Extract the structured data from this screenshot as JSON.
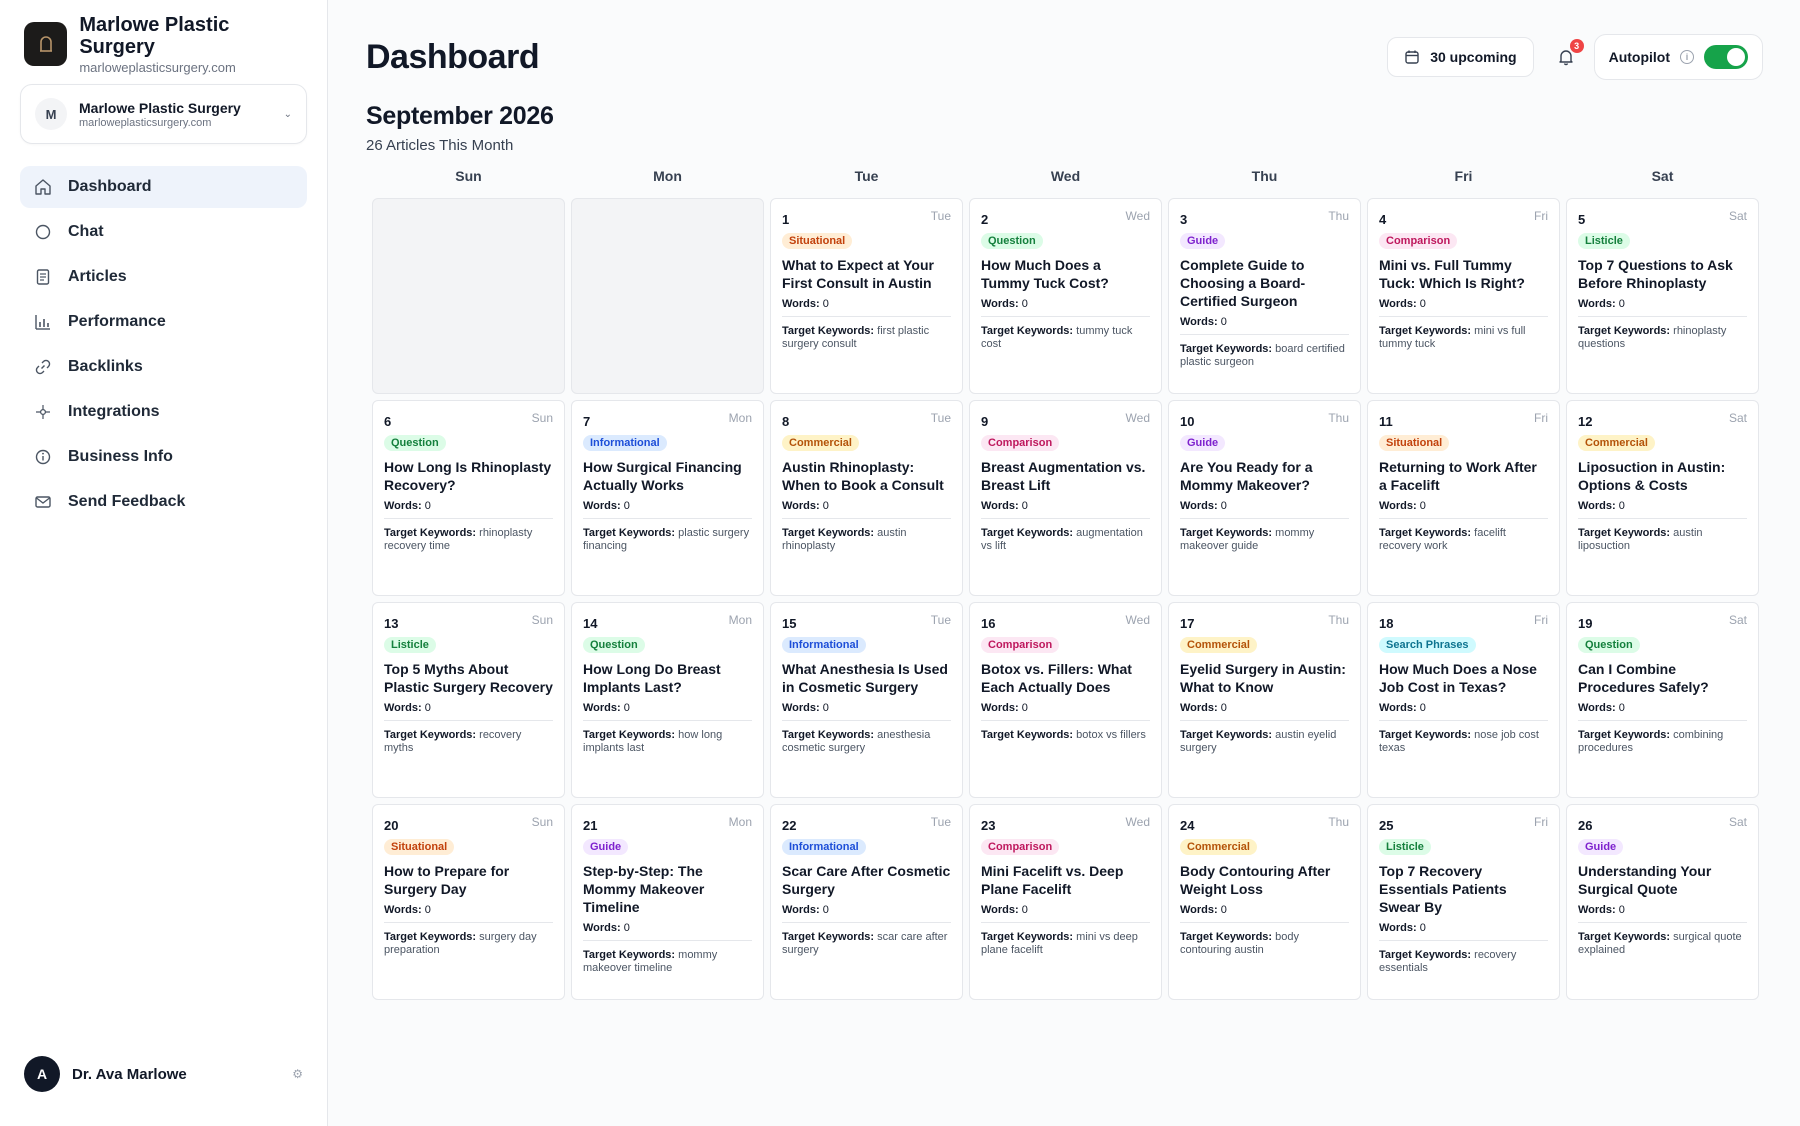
{
  "brand": {
    "name": "Marlowe Plastic Surgery",
    "domain": "marloweplasticsurgery.com"
  },
  "site_select": {
    "initial": "M",
    "name": "Marlowe Plastic Surgery",
    "domain": "marloweplasticsurgery.com"
  },
  "nav": [
    {
      "label": "Dashboard",
      "icon": "home-icon",
      "active": true
    },
    {
      "label": "Chat",
      "icon": "chat-icon"
    },
    {
      "label": "Articles",
      "icon": "document-icon"
    },
    {
      "label": "Performance",
      "icon": "bar-chart-icon"
    },
    {
      "label": "Backlinks",
      "icon": "link-icon"
    },
    {
      "label": "Integrations",
      "icon": "sparkle-icon"
    },
    {
      "label": "Business Info",
      "icon": "info-icon"
    },
    {
      "label": "Send Feedback",
      "icon": "mail-icon"
    }
  ],
  "user": {
    "initial": "A",
    "name": "Dr. Ava Marlowe"
  },
  "header": {
    "title": "Dashboard",
    "upcoming_label": "30 upcoming",
    "notification_count": "3",
    "autopilot_label": "Autopilot",
    "autopilot_on": true
  },
  "calendar": {
    "month_title": "September 2026",
    "subtitle": "26 Articles This Month",
    "weekdays": [
      "Sun",
      "Mon",
      "Tue",
      "Wed",
      "Thu",
      "Fri",
      "Sat"
    ],
    "leading_empty": 2,
    "words_label": "Words:",
    "keywords_label": "Target Keywords:",
    "tag_colors": {
      "Situational": {
        "bg": "#ffedd5",
        "fg": "#c2410c"
      },
      "Question": {
        "bg": "#dcfce7",
        "fg": "#15803d"
      },
      "Guide": {
        "bg": "#f3e8ff",
        "fg": "#7e22ce"
      },
      "Comparison": {
        "bg": "#fce7f3",
        "fg": "#be185d"
      },
      "Listicle": {
        "bg": "#dcfce7",
        "fg": "#15803d"
      },
      "Informational": {
        "bg": "#dbeafe",
        "fg": "#1d4ed8"
      },
      "Commercial": {
        "bg": "#fef3c7",
        "fg": "#b45309"
      },
      "Search Phrases": {
        "bg": "#cffafe",
        "fg": "#0e7490"
      }
    },
    "days": [
      {
        "day": "1",
        "dow": "Tue",
        "tag": "Situational",
        "title": "What to Expect at Your First Consult in Austin",
        "words": "0",
        "keywords": "first plastic surgery consult"
      },
      {
        "day": "2",
        "dow": "Wed",
        "tag": "Question",
        "title": "How Much Does a Tummy Tuck Cost?",
        "words": "0",
        "keywords": "tummy tuck cost"
      },
      {
        "day": "3",
        "dow": "Thu",
        "tag": "Guide",
        "title": "Complete Guide to Choosing a Board-Certified Surgeon",
        "words": "0",
        "keywords": "board certified plastic surgeon"
      },
      {
        "day": "4",
        "dow": "Fri",
        "tag": "Comparison",
        "title": "Mini vs. Full Tummy Tuck: Which Is Right?",
        "words": "0",
        "keywords": "mini vs full tummy tuck"
      },
      {
        "day": "5",
        "dow": "Sat",
        "tag": "Listicle",
        "title": "Top 7 Questions to Ask Before Rhinoplasty",
        "words": "0",
        "keywords": "rhinoplasty questions"
      },
      {
        "day": "6",
        "dow": "Sun",
        "tag": "Question",
        "title": "How Long Is Rhinoplasty Recovery?",
        "words": "0",
        "keywords": "rhinoplasty recovery time"
      },
      {
        "day": "7",
        "dow": "Mon",
        "tag": "Informational",
        "title": "How Surgical Financing Actually Works",
        "words": "0",
        "keywords": "plastic surgery financing"
      },
      {
        "day": "8",
        "dow": "Tue",
        "tag": "Commercial",
        "title": "Austin Rhinoplasty: When to Book a Consult",
        "words": "0",
        "keywords": "austin rhinoplasty"
      },
      {
        "day": "9",
        "dow": "Wed",
        "tag": "Comparison",
        "title": "Breast Augmentation vs. Breast Lift",
        "words": "0",
        "keywords": "augmentation vs lift"
      },
      {
        "day": "10",
        "dow": "Thu",
        "tag": "Guide",
        "title": "Are You Ready for a Mommy Makeover?",
        "words": "0",
        "keywords": "mommy makeover guide"
      },
      {
        "day": "11",
        "dow": "Fri",
        "tag": "Situational",
        "title": "Returning to Work After a Facelift",
        "words": "0",
        "keywords": "facelift recovery work"
      },
      {
        "day": "12",
        "dow": "Sat",
        "tag": "Commercial",
        "title": "Liposuction in Austin: Options & Costs",
        "words": "0",
        "keywords": "austin liposuction"
      },
      {
        "day": "13",
        "dow": "Sun",
        "tag": "Listicle",
        "title": "Top 5 Myths About Plastic Surgery Recovery",
        "words": "0",
        "keywords": "recovery myths"
      },
      {
        "day": "14",
        "dow": "Mon",
        "tag": "Question",
        "title": "How Long Do Breast Implants Last?",
        "words": "0",
        "keywords": "how long implants last"
      },
      {
        "day": "15",
        "dow": "Tue",
        "tag": "Informational",
        "title": "What Anesthesia Is Used in Cosmetic Surgery",
        "words": "0",
        "keywords": "anesthesia cosmetic surgery"
      },
      {
        "day": "16",
        "dow": "Wed",
        "tag": "Comparison",
        "title": "Botox vs. Fillers: What Each Actually Does",
        "words": "0",
        "keywords": "botox vs fillers"
      },
      {
        "day": "17",
        "dow": "Thu",
        "tag": "Commercial",
        "title": "Eyelid Surgery in Austin: What to Know",
        "words": "0",
        "keywords": "austin eyelid surgery"
      },
      {
        "day": "18",
        "dow": "Fri",
        "tag": "Search Phrases",
        "title": "How Much Does a Nose Job Cost in Texas?",
        "words": "0",
        "keywords": "nose job cost texas"
      },
      {
        "day": "19",
        "dow": "Sat",
        "tag": "Question",
        "title": "Can I Combine Procedures Safely?",
        "words": "0",
        "keywords": "combining procedures"
      },
      {
        "day": "20",
        "dow": "Sun",
        "tag": "Situational",
        "title": "How to Prepare for Surgery Day",
        "words": "0",
        "keywords": "surgery day preparation"
      },
      {
        "day": "21",
        "dow": "Mon",
        "tag": "Guide",
        "title": "Step-by-Step: The Mommy Makeover Timeline",
        "words": "0",
        "keywords": "mommy makeover timeline"
      },
      {
        "day": "22",
        "dow": "Tue",
        "tag": "Informational",
        "title": "Scar Care After Cosmetic Surgery",
        "words": "0",
        "keywords": "scar care after surgery"
      },
      {
        "day": "23",
        "dow": "Wed",
        "tag": "Comparison",
        "title": "Mini Facelift vs. Deep Plane Facelift",
        "words": "0",
        "keywords": "mini vs deep plane facelift"
      },
      {
        "day": "24",
        "dow": "Thu",
        "tag": "Commercial",
        "title": "Body Contouring After Weight Loss",
        "words": "0",
        "keywords": "body contouring austin"
      },
      {
        "day": "25",
        "dow": "Fri",
        "tag": "Listicle",
        "title": "Top 7 Recovery Essentials Patients Swear By",
        "words": "0",
        "keywords": "recovery essentials"
      },
      {
        "day": "26",
        "dow": "Sat",
        "tag": "Guide",
        "title": "Understanding Your Surgical Quote",
        "words": "0",
        "keywords": "surgical quote explained"
      }
    ]
  }
}
